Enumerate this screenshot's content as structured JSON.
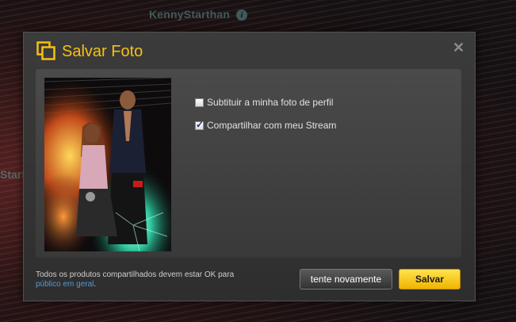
{
  "background": {
    "username": "KennyStarthan",
    "side_username_fragment": "Start"
  },
  "dialog": {
    "title": "Salvar Foto",
    "close_symbol": "✕",
    "options": [
      {
        "label": "Subtituir a minha foto de perfil",
        "checked": false
      },
      {
        "label": "Compartilhar com meu Stream",
        "checked": true
      }
    ],
    "notice_text": "Todos os produtos compartilhados devem estar OK para",
    "notice_link": "público em geral",
    "notice_end": ".",
    "retry_label": "tente novamente",
    "save_label": "Salvar"
  },
  "colors": {
    "accent": "#f6c012",
    "link": "#4f9ad8"
  },
  "icons": {
    "title": "copy-photo-icon",
    "close": "close-icon",
    "info": "info-icon"
  }
}
